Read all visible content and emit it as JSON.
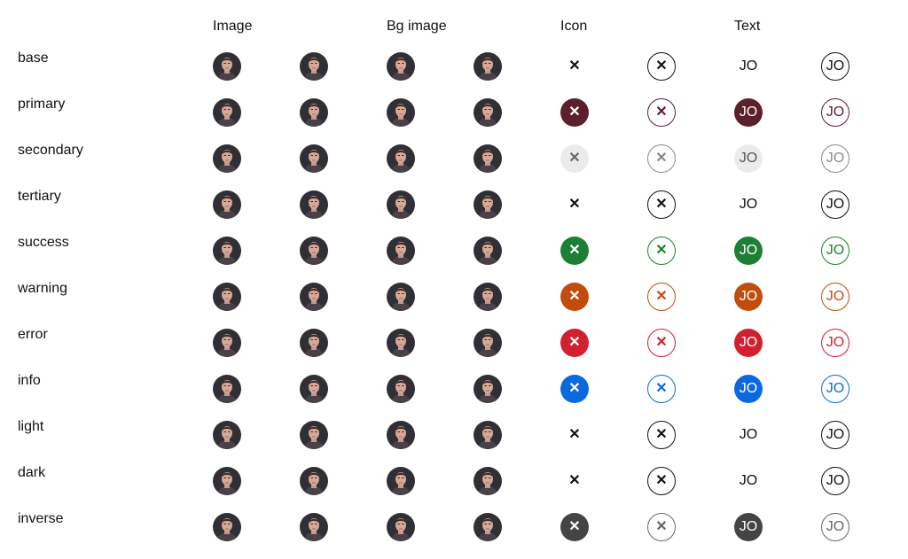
{
  "columns": {
    "image": "Image",
    "bg_image": "Bg image",
    "icon": "Icon",
    "text": "Text"
  },
  "icon_name": "close-icon",
  "icon_glyph": "✕",
  "rows": [
    {
      "label": "base",
      "initials": "JO",
      "icon_solid": {
        "bg": "transparent",
        "fg": "#111111"
      },
      "icon_outline": {
        "border": "#111111",
        "fg": "#111111"
      },
      "text_solid": {
        "bg": "transparent",
        "fg": "#111111"
      },
      "text_outline": {
        "border": "#111111",
        "fg": "#111111"
      }
    },
    {
      "label": "primary",
      "initials": "JO",
      "icon_solid": {
        "bg": "#5c1f2b",
        "fg": "#ffffff"
      },
      "icon_outline": {
        "border": "#5c1f2b",
        "fg": "#5c1f2b"
      },
      "text_solid": {
        "bg": "#5c1f2b",
        "fg": "#ffffff"
      },
      "text_outline": {
        "border": "#5c1f2b",
        "fg": "#5c1f2b"
      }
    },
    {
      "label": "secondary",
      "initials": "JO",
      "icon_solid": {
        "bg": "#ebebeb",
        "fg": "#666666"
      },
      "icon_outline": {
        "border": "#8a8a8a",
        "fg": "#8a8a8a"
      },
      "text_solid": {
        "bg": "#ebebeb",
        "fg": "#555555"
      },
      "text_outline": {
        "border": "#8a8a8a",
        "fg": "#8a8a8a"
      }
    },
    {
      "label": "tertiary",
      "initials": "JO",
      "icon_solid": {
        "bg": "transparent",
        "fg": "#111111"
      },
      "icon_outline": {
        "border": "#111111",
        "fg": "#111111"
      },
      "text_solid": {
        "bg": "transparent",
        "fg": "#111111"
      },
      "text_outline": {
        "border": "#111111",
        "fg": "#111111"
      }
    },
    {
      "label": "success",
      "initials": "JO",
      "icon_solid": {
        "bg": "#1d7f34",
        "fg": "#ffffff"
      },
      "icon_outline": {
        "border": "#1d7f34",
        "fg": "#1d7f34"
      },
      "text_solid": {
        "bg": "#1d7f34",
        "fg": "#ffffff"
      },
      "text_outline": {
        "border": "#1d7f34",
        "fg": "#1d7f34"
      }
    },
    {
      "label": "warning",
      "initials": "JO",
      "icon_solid": {
        "bg": "#c04d0c",
        "fg": "#ffffff"
      },
      "icon_outline": {
        "border": "#c04d0c",
        "fg": "#c04d0c"
      },
      "text_solid": {
        "bg": "#c04d0c",
        "fg": "#ffffff"
      },
      "text_outline": {
        "border": "#c04d0c",
        "fg": "#c04d0c"
      }
    },
    {
      "label": "error",
      "initials": "JO",
      "icon_solid": {
        "bg": "#d3202f",
        "fg": "#ffffff"
      },
      "icon_outline": {
        "border": "#d3202f",
        "fg": "#d3202f"
      },
      "text_solid": {
        "bg": "#d3202f",
        "fg": "#ffffff"
      },
      "text_outline": {
        "border": "#d3202f",
        "fg": "#d3202f"
      }
    },
    {
      "label": "info",
      "initials": "JO",
      "icon_solid": {
        "bg": "#0b69df",
        "fg": "#ffffff"
      },
      "icon_outline": {
        "border": "#0b69df",
        "fg": "#0b69df"
      },
      "text_solid": {
        "bg": "#0b69df",
        "fg": "#ffffff"
      },
      "text_outline": {
        "border": "#0b69df",
        "fg": "#0b69df"
      }
    },
    {
      "label": "light",
      "initials": "JO",
      "icon_solid": {
        "bg": "transparent",
        "fg": "#111111"
      },
      "icon_outline": {
        "border": "#111111",
        "fg": "#111111"
      },
      "text_solid": {
        "bg": "transparent",
        "fg": "#111111"
      },
      "text_outline": {
        "border": "#111111",
        "fg": "#111111"
      }
    },
    {
      "label": "dark",
      "initials": "JO",
      "icon_solid": {
        "bg": "transparent",
        "fg": "#111111"
      },
      "icon_outline": {
        "border": "#111111",
        "fg": "#111111"
      },
      "text_solid": {
        "bg": "transparent",
        "fg": "#111111"
      },
      "text_outline": {
        "border": "#111111",
        "fg": "#111111"
      }
    },
    {
      "label": "inverse",
      "initials": "JO",
      "icon_solid": {
        "bg": "#444444",
        "fg": "#ffffff"
      },
      "icon_outline": {
        "border": "#666666",
        "fg": "#666666"
      },
      "text_solid": {
        "bg": "#444444",
        "fg": "#ffffff"
      },
      "text_outline": {
        "border": "#666666",
        "fg": "#666666"
      }
    }
  ]
}
